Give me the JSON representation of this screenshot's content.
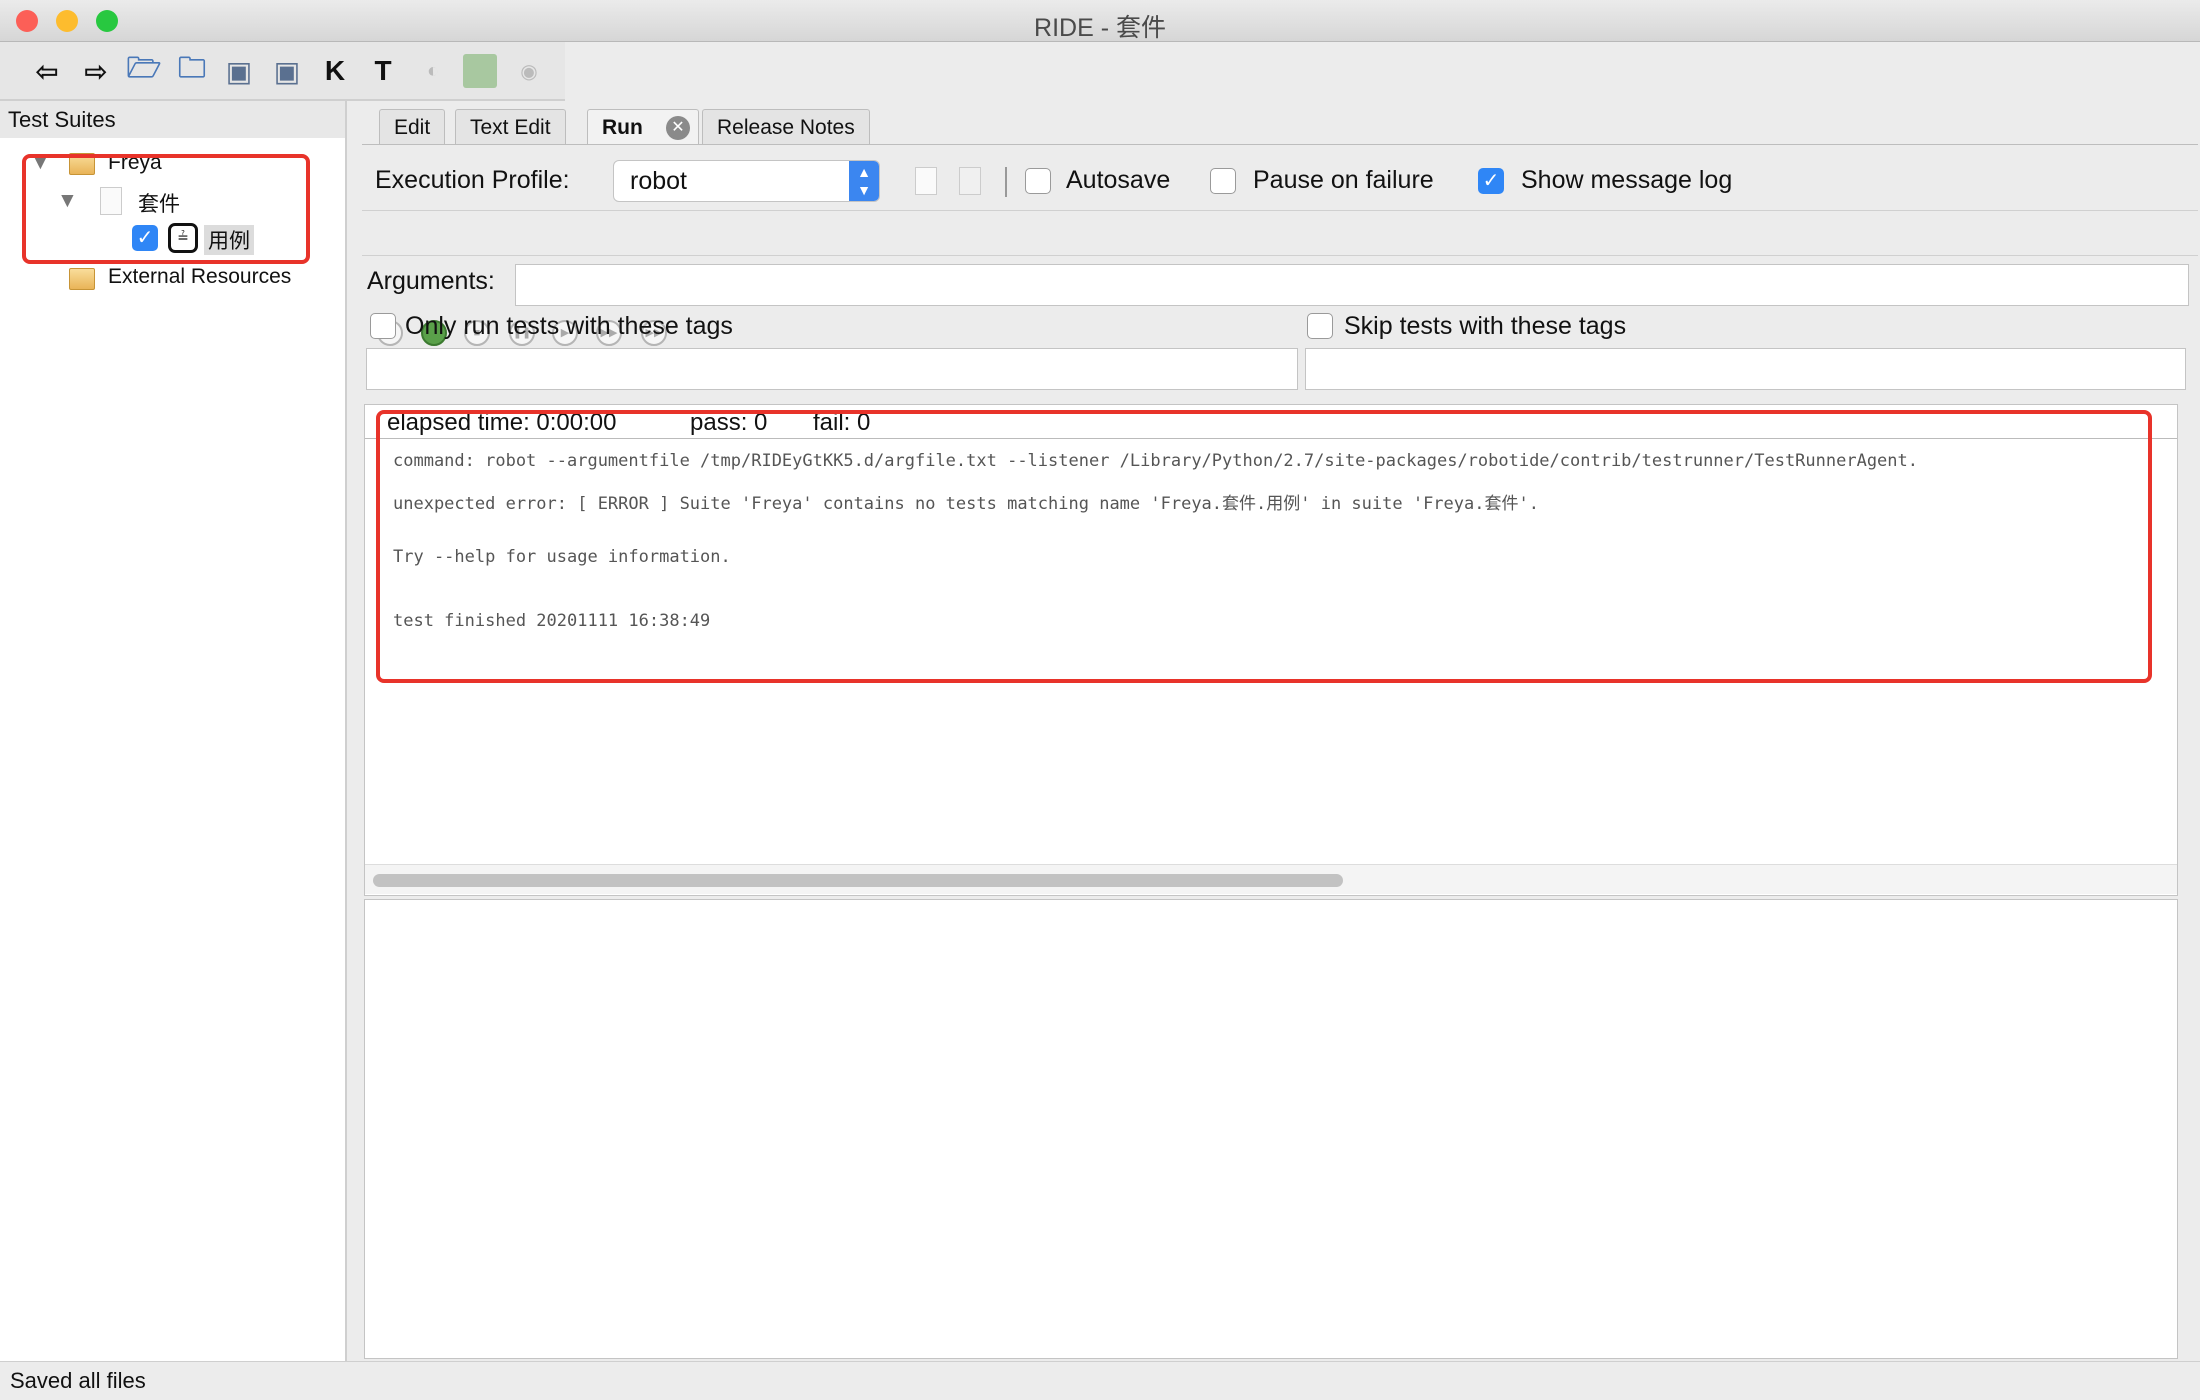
{
  "window": {
    "title": "RIDE - 套件"
  },
  "toolbar": {
    "icons": [
      "back-arrow",
      "forward-arrow",
      "open-suite",
      "open-directory",
      "save",
      "save-all",
      "search-keywords",
      "search-tests",
      "run",
      "debug",
      "stop"
    ]
  },
  "tree": {
    "header": "Test Suites",
    "items": [
      {
        "label": "Freya"
      },
      {
        "label": "套件"
      },
      {
        "label": "用例",
        "checked": true
      },
      {
        "label": "External Resources"
      }
    ]
  },
  "tabs": [
    {
      "label": "Edit"
    },
    {
      "label": "Text Edit"
    },
    {
      "label": "Run",
      "active": true
    },
    {
      "label": "Release Notes"
    }
  ],
  "run": {
    "execution_profile_label": "Execution Profile:",
    "execution_profile_value": "robot",
    "autosave_label": "Autosave",
    "autosave": false,
    "pause_label": "Pause on failure",
    "pause": false,
    "show_log_label": "Show message log",
    "show_log": true,
    "arguments_label": "Arguments:",
    "arguments_value": "",
    "only_tags_label": "Only run tests with these tags",
    "only_tags": false,
    "skip_tags_label": "Skip tests with these tags",
    "skip_tags": false,
    "elapsed": "elapsed time: 0:00:00",
    "pass": "pass: 0",
    "fail": "fail: 0",
    "log": [
      "command: robot --argumentfile /tmp/RIDEyGtKK5.d/argfile.txt --listener /Library/Python/2.7/site-packages/robotide/contrib/testrunner/TestRunnerAgent.",
      "unexpected error: [ ERROR ] Suite 'Freya' contains no tests matching name 'Freya.套件.用例' in suite 'Freya.套件'.",
      "Try --help for usage information.",
      "test finished 20201111 16:38:49"
    ]
  },
  "status": {
    "text": "Saved all files"
  },
  "colors": {
    "highlight": "#e8332a",
    "checkbox": "#2f86f6"
  }
}
